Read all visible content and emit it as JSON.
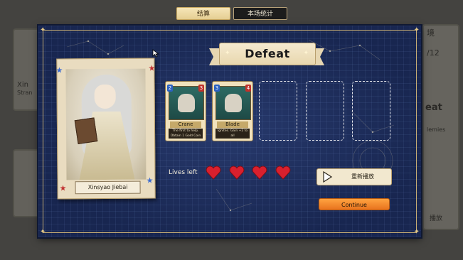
{
  "tabs": [
    {
      "label": "结算",
      "active": true
    },
    {
      "label": "本场统计",
      "active": false
    }
  ],
  "result": {
    "title": "Defeat"
  },
  "character": {
    "name": "Xinsyao Jiebai"
  },
  "cards": [
    {
      "name": "Crane",
      "cost": "2",
      "power": "3",
      "description": "The first to help. Obtain 1 Gold Coin"
    },
    {
      "name": "Blade",
      "cost": "3",
      "power": "4",
      "description": "Ignites. Gain +2 to all"
    }
  ],
  "empty_slots": 3,
  "lives": {
    "label": "Lives left",
    "count": 4,
    "color": "#d9202e"
  },
  "buttons": {
    "replay": "重新播放",
    "continue": "Continue"
  },
  "colors": {
    "panel": "#1d2d58",
    "continue": "#f08a2a",
    "accent": "#c7ad74"
  },
  "background": {
    "left_name": "Xin",
    "left_sub": "Stran",
    "right_title": "境",
    "right_counter": "/12",
    "right_word": "eat",
    "right_sub": "lemies",
    "right_button": "播放"
  }
}
